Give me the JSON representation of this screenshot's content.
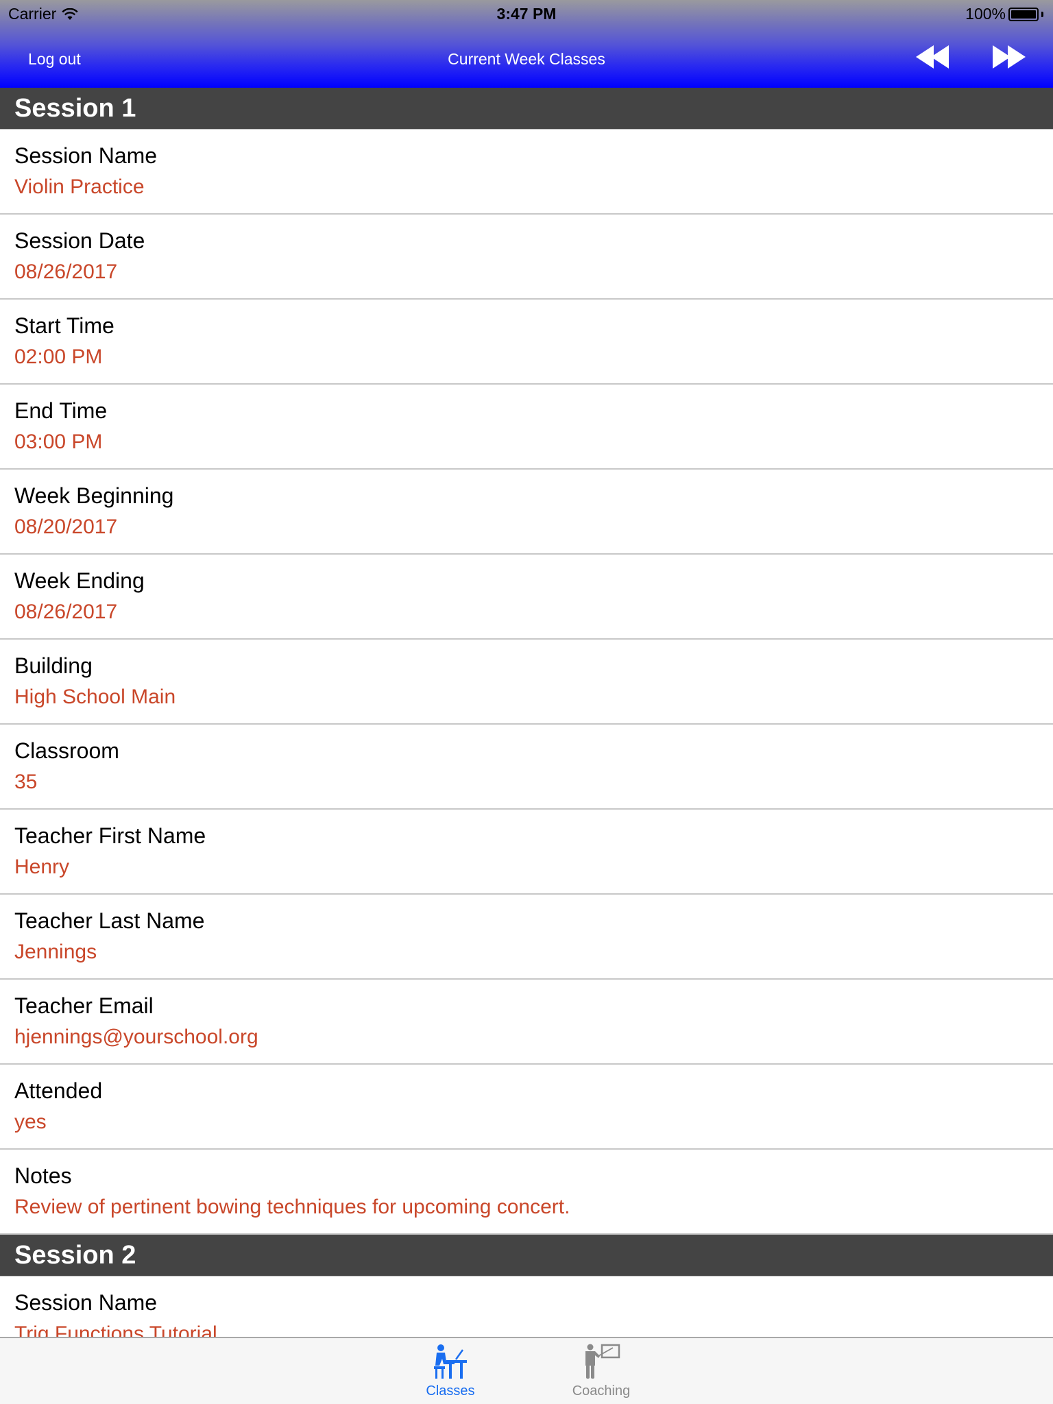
{
  "status_bar": {
    "carrier": "Carrier",
    "time": "3:47 PM",
    "battery": "100%"
  },
  "nav": {
    "logout_label": "Log out",
    "title": "Current Week Classes",
    "prev_icon": "rewind-icon",
    "next_icon": "fast-forward-icon"
  },
  "colors": {
    "value_text": "#c9472a",
    "section_header_bg": "#444444",
    "tab_active": "#1a6ef0",
    "tab_inactive": "#8a8a8a"
  },
  "sessions": [
    {
      "title": "Session 1",
      "fields": [
        {
          "label": "Session Name",
          "value": "Violin Practice"
        },
        {
          "label": "Session Date",
          "value": "08/26/2017"
        },
        {
          "label": "Start Time",
          "value": "02:00 PM"
        },
        {
          "label": "End Time",
          "value": "03:00 PM"
        },
        {
          "label": "Week Beginning",
          "value": "08/20/2017"
        },
        {
          "label": "Week Ending",
          "value": "08/26/2017"
        },
        {
          "label": "Building",
          "value": "High School Main"
        },
        {
          "label": "Classroom",
          "value": "35"
        },
        {
          "label": "Teacher First Name",
          "value": "Henry"
        },
        {
          "label": "Teacher Last Name",
          "value": "Jennings"
        },
        {
          "label": "Teacher Email",
          "value": "hjennings@yourschool.org"
        },
        {
          "label": "Attended",
          "value": "yes"
        },
        {
          "label": "Notes",
          "value": "Review of pertinent bowing techniques for upcoming concert."
        }
      ]
    },
    {
      "title": "Session 2",
      "fields": [
        {
          "label": "Session Name",
          "value": "Trig Functions Tutorial"
        }
      ]
    }
  ],
  "tabbar": {
    "tabs": [
      {
        "label": "Classes",
        "icon": "student-desk-icon",
        "active": true
      },
      {
        "label": "Coaching",
        "icon": "teacher-board-icon",
        "active": false
      }
    ]
  }
}
